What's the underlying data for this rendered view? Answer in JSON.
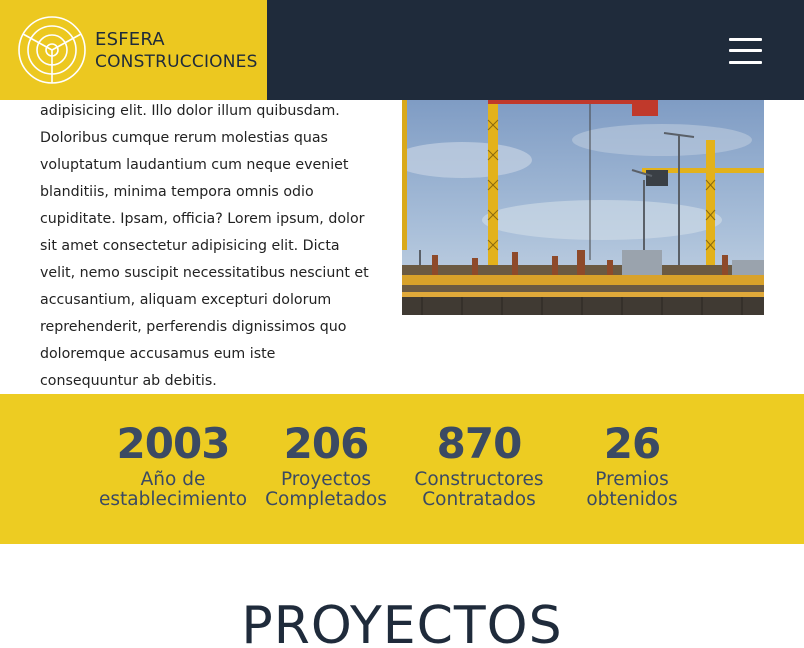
{
  "header": {
    "brand": "ESFERA",
    "subtitle": "CONSTRUCCIONES",
    "logo_icon": "sphere-logo-icon",
    "menu_icon": "hamburger-menu-icon",
    "colors": {
      "header_bg": "#1f2b3b",
      "accent": "#ecc820"
    }
  },
  "about": {
    "text": "adipisicing elit. Illo dolor illum quibusdam. Doloribus cumque rerum molestias quas voluptatum laudantium cum neque eveniet blanditiis, minima tempora omnis odio cupiditate. Ipsam, officia? Lorem ipsum, dolor sit amet consectetur adipisicing elit. Dicta velit, nemo suscipit necessitatibus nesciunt et accusantium, aliquam excepturi dolorum reprehenderit, perferendis dignissimos quo doloremque accusamus eum iste consequuntur ab debitis.",
    "image": "construction-site-cranes-photo"
  },
  "stats": [
    {
      "number": "2003",
      "label_line1": "Año de",
      "label_line2": "establecimiento"
    },
    {
      "number": "206",
      "label_line1": "Proyectos",
      "label_line2": "Completados"
    },
    {
      "number": "870",
      "label_line1": "Constructores",
      "label_line2": "Contratados"
    },
    {
      "number": "26",
      "label_line1": "Premios",
      "label_line2": "obtenidos"
    }
  ],
  "projects": {
    "title": "PROYECTOS"
  }
}
